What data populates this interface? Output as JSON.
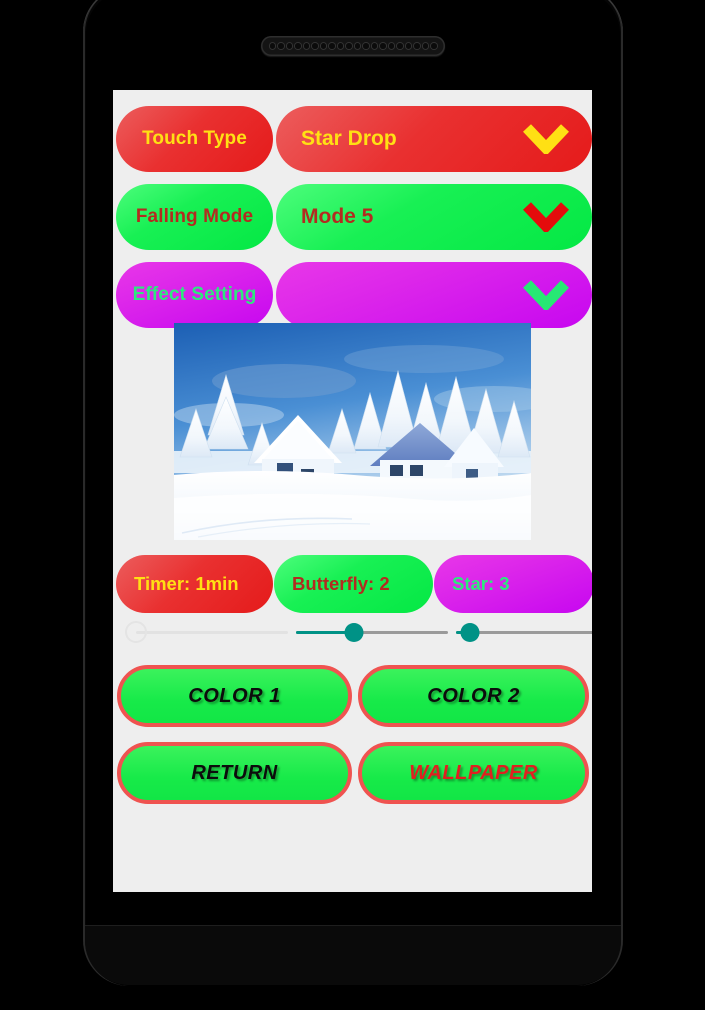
{
  "device": {
    "speaker_hole_count": 20,
    "bezel_color": "#000000",
    "screen_bg": "#eeeeee"
  },
  "app": {
    "dropdown_rows": [
      {
        "label": "Touch Type",
        "value": "Star Drop",
        "theme": "red",
        "label_text_color": "#ffe014",
        "value_text_color": "#ffe014",
        "chevron_icon": "chevron-down-icon",
        "chevron_color": "#ffe014"
      },
      {
        "label": "Falling Mode",
        "value": "Mode 5",
        "theme": "green",
        "label_text_color": "#b32b20",
        "value_text_color": "#b32b20",
        "chevron_icon": "chevron-down-icon",
        "chevron_color": "#e40c0c"
      },
      {
        "label": "Effect Setting",
        "value": "",
        "theme": "magenta",
        "label_text_color": "#2ee87e",
        "value_text_color": "#2ee87e",
        "chevron_icon": "chevron-down-icon",
        "chevron_color": "#27e874"
      }
    ],
    "preview": {
      "name": "wallpaper-preview",
      "description": "Winter snow scene with snow covered house and pine trees under blue sky"
    },
    "chips": [
      {
        "label": "Timer: 1min",
        "theme": "red",
        "text_color": "#ffe014"
      },
      {
        "label": "Butterfly: 2",
        "theme": "green",
        "text_color": "#b32b20"
      },
      {
        "label": "Star: 3",
        "theme": "magenta",
        "text_color": "#2ee87e"
      }
    ],
    "sliders": [
      {
        "name": "timer-slider",
        "percent": 0,
        "enabled": false
      },
      {
        "name": "butterfly-slider",
        "percent": 38,
        "enabled": true
      },
      {
        "name": "star-slider",
        "percent": 9,
        "enabled": true
      }
    ],
    "buttons": [
      {
        "label": "COLOR 1",
        "text_color": "#0c0c0c"
      },
      {
        "label": "COLOR 2",
        "text_color": "#0c0c0c"
      },
      {
        "label": "RETURN",
        "text_color": "#0c0c0c"
      },
      {
        "label": "WALLPAPER",
        "text_color": "#e02020"
      }
    ],
    "colors": {
      "accent_teal": "#009286",
      "button_green": "#17ea49",
      "button_border_red": "#ef5350",
      "track_grey": "#9a9a9a"
    }
  }
}
